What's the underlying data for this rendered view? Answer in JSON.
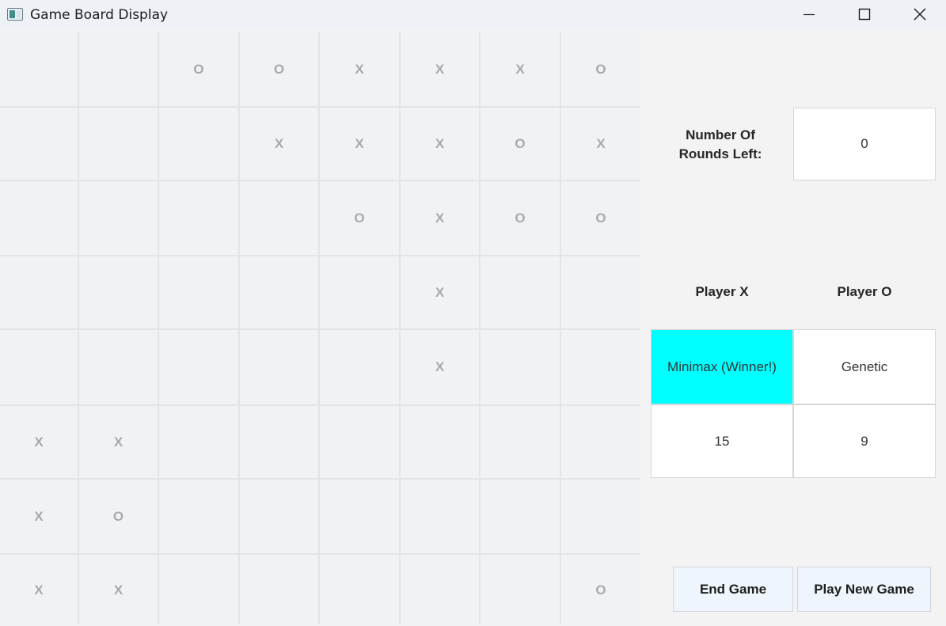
{
  "window": {
    "title": "Game Board Display"
  },
  "board": {
    "rows": [
      [
        "",
        "",
        "O",
        "O",
        "X",
        "X",
        "X",
        "O"
      ],
      [
        "",
        "",
        "",
        "X",
        "X",
        "X",
        "O",
        "X"
      ],
      [
        "",
        "",
        "",
        "",
        "O",
        "X",
        "O",
        "O"
      ],
      [
        "",
        "",
        "",
        "",
        "",
        "X",
        "",
        ""
      ],
      [
        "",
        "",
        "",
        "",
        "",
        "X",
        "",
        ""
      ],
      [
        "X",
        "X",
        "",
        "",
        "",
        "",
        "",
        ""
      ],
      [
        "X",
        "O",
        "",
        "",
        "",
        "",
        "",
        ""
      ],
      [
        "X",
        "X",
        "",
        "",
        "",
        "",
        "",
        "O"
      ]
    ]
  },
  "panel": {
    "rounds_label": "Number Of\nRounds Left:",
    "rounds_value": "0",
    "player_x_label": "Player X",
    "player_o_label": "Player O",
    "player_x_name": "Minimax (Winner!)",
    "player_o_name": "Genetic",
    "player_x_score": "15",
    "player_o_score": "9",
    "winner_color": "#00ffff"
  },
  "buttons": {
    "end_game": "End Game",
    "play_new_game": "Play New Game"
  },
  "icons": [
    "app-icon",
    "minimize-icon",
    "maximize-icon",
    "close-icon"
  ]
}
